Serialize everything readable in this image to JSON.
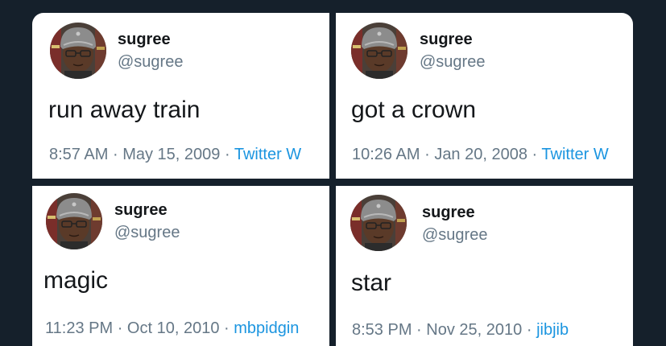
{
  "tweets": [
    {
      "author": {
        "name": "sugree",
        "handle": "@sugree"
      },
      "text": "run away train",
      "time": "8:57 AM",
      "date": "May 15, 2009",
      "source": "Twitter W"
    },
    {
      "author": {
        "name": "sugree",
        "handle": "@sugree"
      },
      "text": "got a crown",
      "time": "10:26 AM",
      "date": "Jan 20, 2008",
      "source": "Twitter W"
    },
    {
      "author": {
        "name": "sugree",
        "handle": "@sugree"
      },
      "text": "magic",
      "time": "11:23 PM",
      "date": "Oct 10, 2010",
      "source": "mbpidgin"
    },
    {
      "author": {
        "name": "sugree",
        "handle": "@sugree"
      },
      "text": "star",
      "time": "8:53 PM",
      "date": "Nov 25, 2010",
      "source": "jibjib"
    }
  ],
  "separator": "·",
  "icons": {
    "avatar": "profile-photo"
  },
  "colors": {
    "background": "#15202b",
    "card": "#ffffff",
    "text": "#14171a",
    "muted": "#657786",
    "link": "#1b95e0"
  }
}
